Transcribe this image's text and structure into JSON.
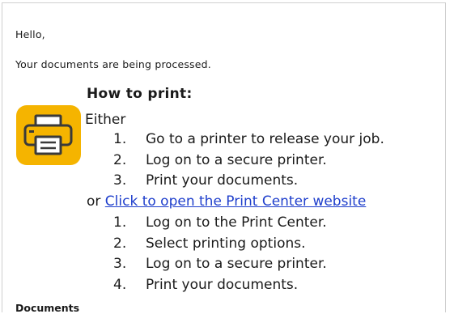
{
  "email": {
    "greeting": "Hello,",
    "intro": "Your documents are being processed.",
    "how_to_heading": "How to print:",
    "either_label": "Either",
    "option_one_steps": [
      {
        "num": "1.",
        "text": "Go to a printer to release your job."
      },
      {
        "num": "2.",
        "text": "Log on to a secure printer."
      },
      {
        "num": "3.",
        "text": "Print your documents."
      }
    ],
    "or_label": "or",
    "print_center_link": "Click to open the Print Center website",
    "option_two_steps": [
      {
        "num": "1.",
        "text": "Log on to the Print Center."
      },
      {
        "num": "2.",
        "text": "Select printing options."
      },
      {
        "num": "3.",
        "text": "Log on to a secure printer."
      },
      {
        "num": "4.",
        "text": "Print your documents."
      }
    ],
    "documents_heading": "Documents",
    "icon": "printer-icon",
    "colors": {
      "icon_background": "#f5b400",
      "link": "#1f3fcc"
    }
  }
}
